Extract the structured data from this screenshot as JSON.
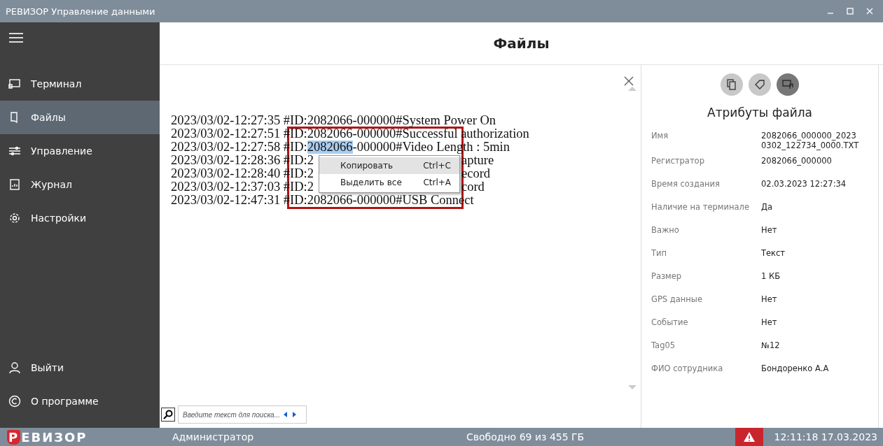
{
  "window": {
    "title": "РЕВИЗОР Управление данными"
  },
  "sidebar": {
    "items": [
      {
        "label": "Терминал",
        "selected": false
      },
      {
        "label": "Файлы",
        "selected": true
      },
      {
        "label": "Управление",
        "selected": false
      },
      {
        "label": "Журнал",
        "selected": false
      },
      {
        "label": "Настройки",
        "selected": false
      }
    ],
    "bottom_items": [
      {
        "label": "Выйти",
        "selected": false
      },
      {
        "label": "О программе",
        "selected": false
      }
    ]
  },
  "header": {
    "title": "Файлы"
  },
  "log": {
    "lines": [
      {
        "head": "2023/03/02-12:27:35 #ID:2082066-000000#System Power On"
      },
      {
        "head": "2023/03/02-12:27:51 #ID:2082066-000000#Successful authorization"
      },
      {
        "head": "2023/03/02-12:27:58 #ID:",
        "selected": "2082066",
        "after": "-000000#Video Length : 5min"
      },
      {
        "head": "2023/03/02-12:28:36 #ID:2",
        "tail": "apture"
      },
      {
        "head": "2023/03/02-12:28:40 #ID:2",
        "tail": "ecord"
      },
      {
        "head": "2023/03/02-12:37:03 #ID:2",
        "tail": "cord"
      },
      {
        "head": "2023/03/02-12:47:31 #ID:2082066-000000#USB Connect"
      }
    ],
    "context_menu": [
      {
        "label": "Копировать",
        "shortcut": "Ctrl+C",
        "selected": true
      },
      {
        "label": "Выделить все",
        "shortcut": "Ctrl+A",
        "selected": false
      }
    ],
    "search": {
      "placeholder": "Введите текст для поиска..."
    }
  },
  "attributes": {
    "title": "Атрибуты файла",
    "rows": [
      {
        "label": "Имя",
        "value": "2082066_000000_2023 0302_122734_0000.TXT"
      },
      {
        "label": "Регистратор",
        "value": "2082066_000000"
      },
      {
        "label": "Время создания",
        "value": "02.03.2023 12:27:34"
      },
      {
        "label": "Наличие на терминале",
        "value": "Да"
      },
      {
        "label": "Важно",
        "value": "Нет"
      },
      {
        "label": "Тип",
        "value": "Текст"
      },
      {
        "label": "Размер",
        "value": "1 КБ"
      },
      {
        "label": "GPS данные",
        "value": "Нет"
      },
      {
        "label": "Событие",
        "value": "Нет"
      },
      {
        "label": "Tag05",
        "value": "№12"
      },
      {
        "label": "ФИО сотрудника",
        "value": "Бондоренко А.А"
      }
    ]
  },
  "status_bar": {
    "logo_initial": "Р",
    "logo_rest": "ЕВИЗОР",
    "user": "Администратор",
    "storage": "Свободно 69 из 455 ГБ",
    "datetime": "12:11:18 17.03.2023"
  }
}
